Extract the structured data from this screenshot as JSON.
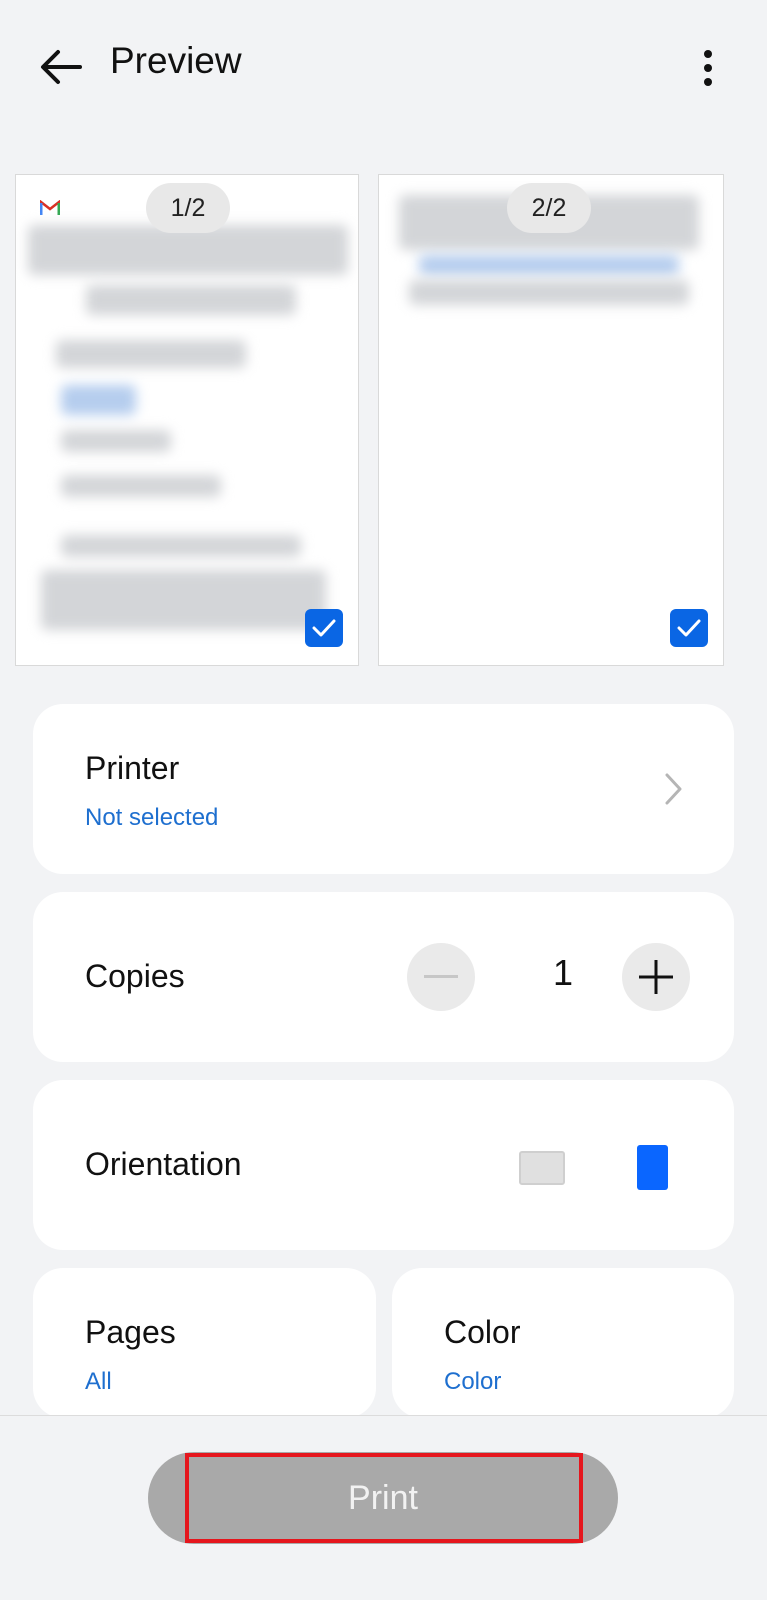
{
  "header": {
    "title": "Preview",
    "back_icon": "arrow-left-icon",
    "more_icon": "more-vert-icon"
  },
  "previews": [
    {
      "page_label": "1/2",
      "selected": true
    },
    {
      "page_label": "2/2",
      "selected": true
    }
  ],
  "printer": {
    "label": "Printer",
    "value": "Not selected"
  },
  "copies": {
    "label": "Copies",
    "value": "1"
  },
  "orientation": {
    "label": "Orientation",
    "selected": "portrait"
  },
  "pages": {
    "label": "Pages",
    "value": "All"
  },
  "color": {
    "label": "Color",
    "value": "Color"
  },
  "footer": {
    "print_label": "Print"
  },
  "colors": {
    "accent": "#0a66e4",
    "link": "#1e6fcf",
    "highlight": "#e5161d"
  }
}
